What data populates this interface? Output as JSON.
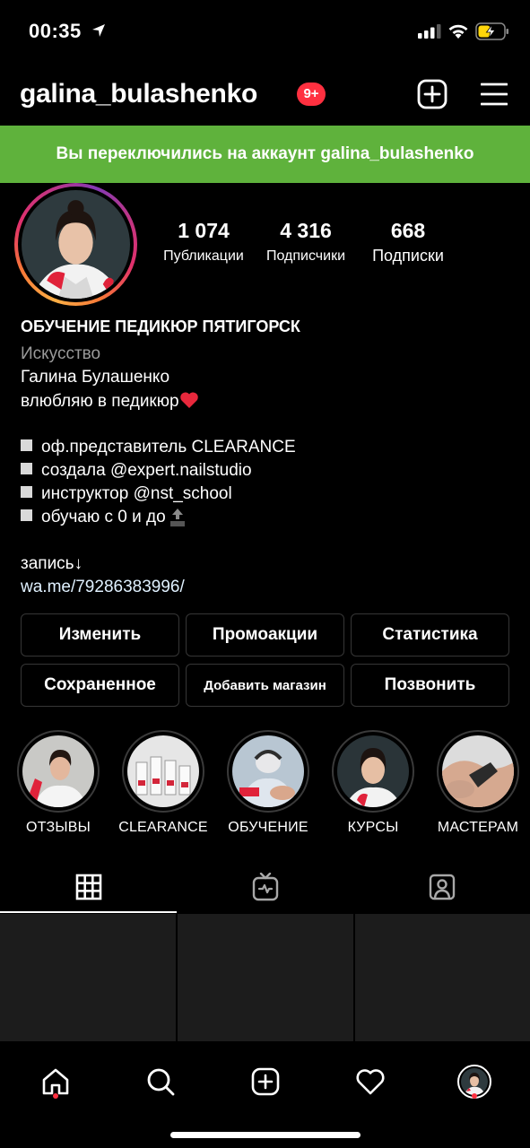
{
  "status_bar": {
    "time": "00:35",
    "icons": [
      "location-arrow-icon",
      "signal-icon",
      "wifi-icon",
      "battery-charging-icon"
    ]
  },
  "header": {
    "username": "galina_bulashenko",
    "notification_badge": "9+",
    "icons": [
      "new-post-icon",
      "menu-icon"
    ]
  },
  "banner": {
    "text": "Вы переключились на аккаунт galina_bulashenko",
    "color": "#5fb23c"
  },
  "stats": [
    {
      "value": "1 074",
      "label": "Публикации"
    },
    {
      "value": "4 316",
      "label": "Подписчики"
    },
    {
      "value": "668",
      "label": "Подписки"
    }
  ],
  "bio": {
    "name": "ОБУЧЕНИЕ ПЕДИКЮР ПЯТИГОРСК",
    "category": "Искусство",
    "full_name": "Галина Булашенко",
    "tagline": "влюбляю в педикюр",
    "bullets": [
      "оф.представитель CLEARANCE",
      "создала @expert.nailstudio",
      "инструктор @nst_school",
      "обучаю с 0 и до"
    ],
    "booking": "запись↓",
    "link": "wa.me/79286383996/"
  },
  "buttons": {
    "edit": "Изменить",
    "promotions": "Промоакции",
    "insights": "Статистика",
    "saved": "Сохраненное",
    "add_shop": "Добавить магазин",
    "call": "Позвонить"
  },
  "highlights": [
    {
      "label": "ОТЗЫВЫ"
    },
    {
      "label": "CLEARANCE"
    },
    {
      "label": "ОБУЧЕНИЕ"
    },
    {
      "label": "КУРСЫ"
    },
    {
      "label": "МАСТЕРАМ"
    }
  ],
  "tabs": [
    "grid-icon",
    "igtv-icon",
    "tagged-icon"
  ],
  "bottom_nav": [
    "home-icon",
    "search-icon",
    "new-post-icon",
    "heart-icon",
    "profile-avatar"
  ],
  "colors": {
    "background": "#000000",
    "badge": "#ff3040",
    "banner": "#5fb23c",
    "button_border": "#363636",
    "muted_text": "#9a9a9a"
  }
}
